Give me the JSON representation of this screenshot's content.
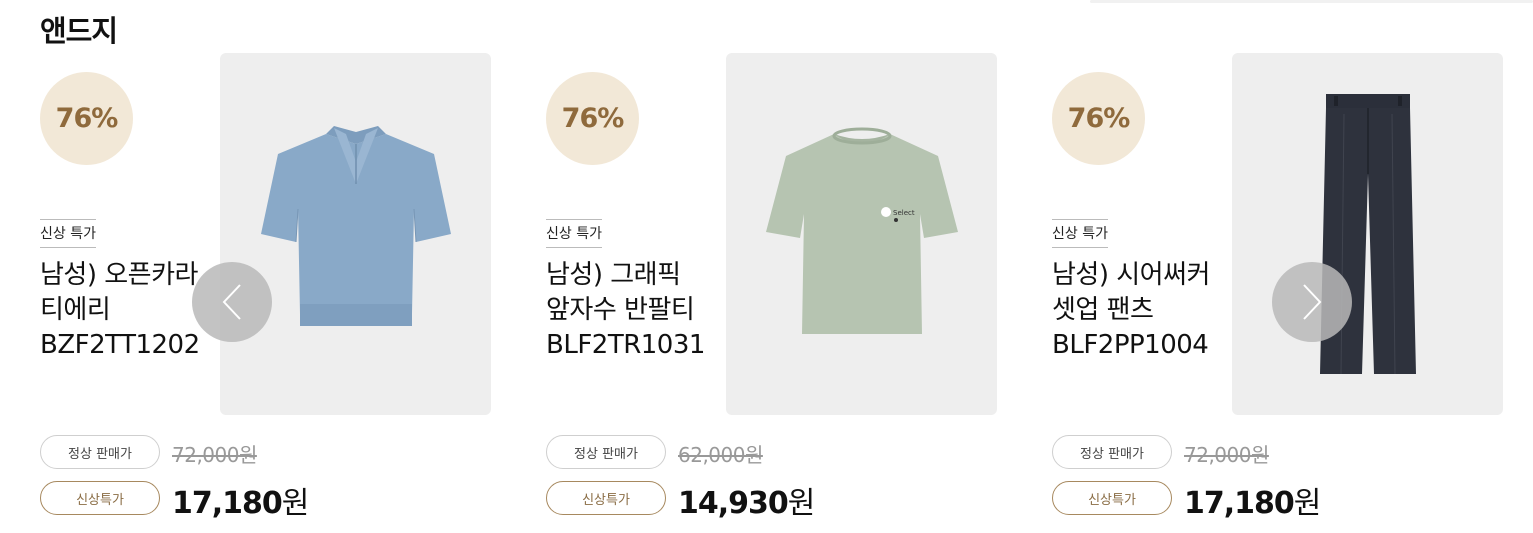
{
  "section": {
    "title": "앤드지"
  },
  "products": [
    {
      "discount": "76%",
      "badge": "신상 특가",
      "name_lines": [
        "남성) 오픈카라",
        "티에리",
        "BZF2TT1202"
      ],
      "regular_label": "정상 판매가",
      "regular_price": "72,000원",
      "sale_label": "신상특가",
      "sale_price": "17,180",
      "sale_unit": "원",
      "image": "polo-shirt-light-blue"
    },
    {
      "discount": "76%",
      "badge": "신상 특가",
      "name_lines": [
        "남성) 그래픽",
        "앞자수 반팔티",
        "BLF2TR1031"
      ],
      "regular_label": "정상 판매가",
      "regular_price": "62,000원",
      "sale_label": "신상특가",
      "sale_price": "14,930",
      "sale_unit": "원",
      "image": "tshirt-sage-green"
    },
    {
      "discount": "76%",
      "badge": "신상 특가",
      "name_lines": [
        "남성) 시어써커",
        "셋업 팬츠",
        "BLF2PP1004"
      ],
      "regular_label": "정상 판매가",
      "regular_price": "72,000원",
      "sale_label": "신상특가",
      "sale_price": "17,180",
      "sale_unit": "원",
      "image": "pants-navy"
    }
  ],
  "carousel": {
    "prev_icon": "chevron-left-icon",
    "next_icon": "chevron-right-icon"
  },
  "colors": {
    "discount_bg": "#f2e8d7",
    "discount_text": "#8f6a3c",
    "sale_border": "#a7895f",
    "image_bg": "#eeeeee"
  }
}
